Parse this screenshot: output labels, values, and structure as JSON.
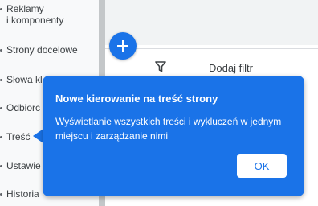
{
  "sidebar": {
    "items": [
      {
        "label_line1": "Reklamy",
        "label_line2": "i komponenty"
      },
      {
        "label": "Strony docelowe"
      },
      {
        "label": "Słowa kl"
      },
      {
        "label": "Odbiorc"
      },
      {
        "label": "Treść"
      },
      {
        "label": "Ustawie"
      },
      {
        "label": "Historia"
      }
    ]
  },
  "main": {
    "fab_icon": "add-icon",
    "fab_symbol": "+",
    "filter_icon": "filter-icon",
    "filter_label": "Dodaj filtr"
  },
  "callout": {
    "title": "Nowe kierowanie na treść strony",
    "body": "Wyświetlanie wszystkich treści i wykluczeń w jednym miejscu i zarządzanie nimi",
    "ok_label": "OK",
    "color": "#1a73e8"
  },
  "colors": {
    "accent": "#1a73e8",
    "sidebar_bg": "#f8f9fa",
    "text": "#3c4043"
  }
}
